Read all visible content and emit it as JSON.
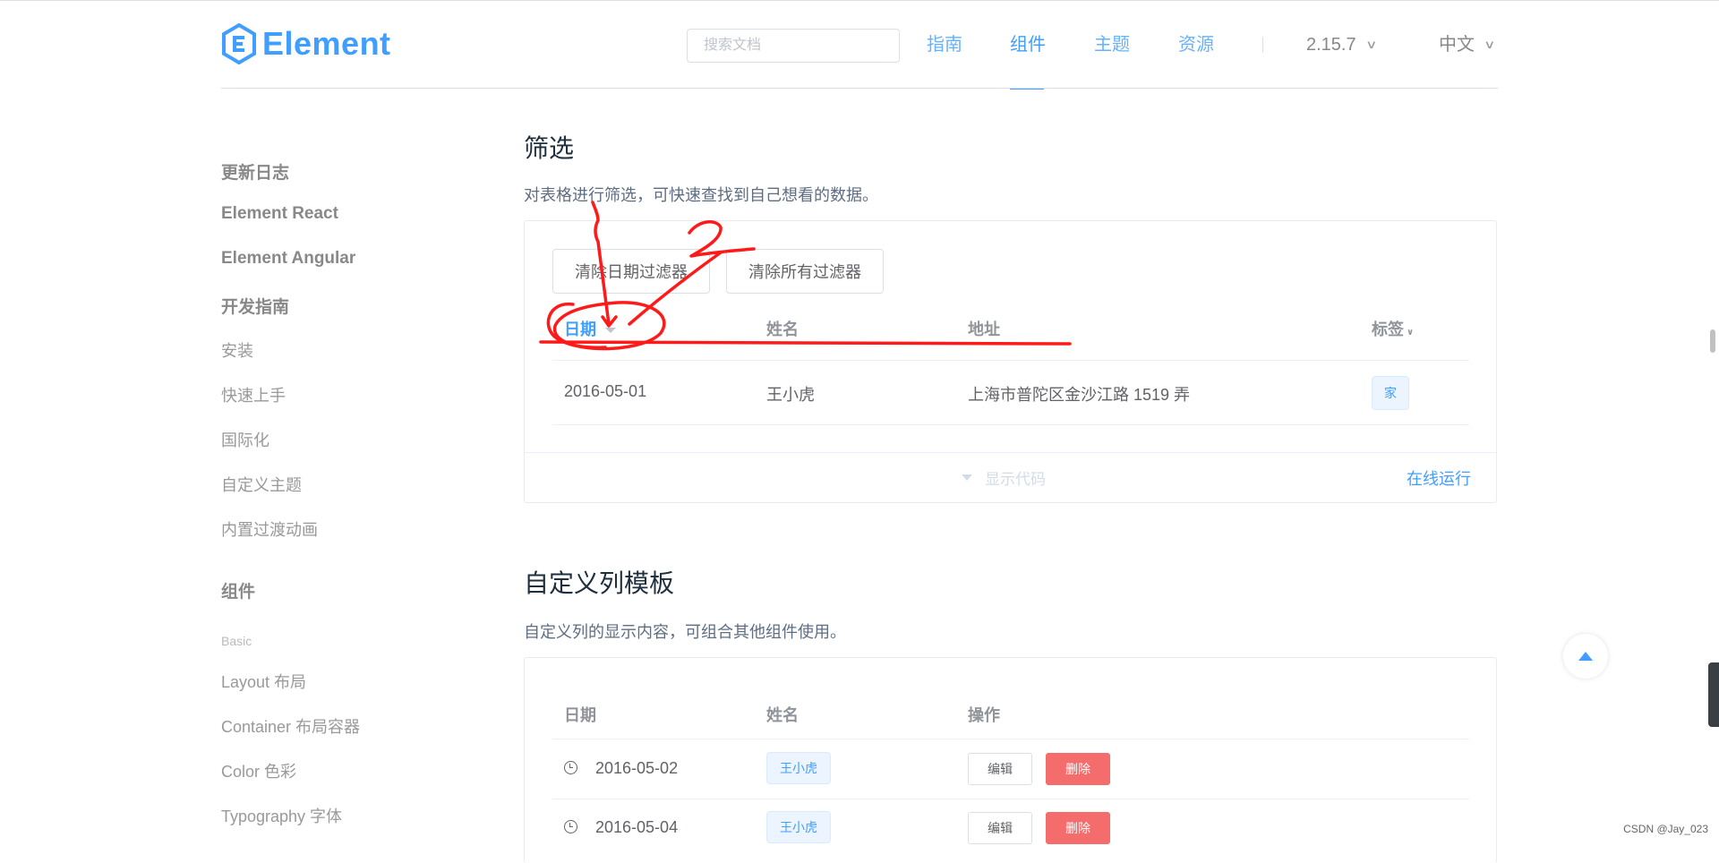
{
  "header": {
    "logo_text": "Element",
    "search_placeholder": "搜索文档",
    "nav": [
      "指南",
      "组件",
      "主题",
      "资源"
    ],
    "active_nav": "组件",
    "version": "2.15.7",
    "language": "中文"
  },
  "sidebar": {
    "items": [
      "更新日志",
      "Element React",
      "Element Angular",
      "开发指南",
      "安装",
      "快速上手",
      "国际化",
      "自定义主题",
      "内置过渡动画",
      "组件",
      "Basic",
      "Layout 布局",
      "Container 布局容器",
      "Color 色彩",
      "Typography 字体"
    ]
  },
  "filter_section": {
    "title": "筛选",
    "desc": "对表格进行筛选，可快速查找到自己想看的数据。",
    "buttons": [
      "清除日期过滤器",
      "清除所有过滤器"
    ],
    "columns": [
      "日期",
      "姓名",
      "地址",
      "标签"
    ],
    "row": {
      "date": "2016-05-01",
      "name": "王小虎",
      "address": "上海市普陀区金沙江路 1519 弄",
      "tag": "家"
    },
    "show_code": "显示代码",
    "run_online": "在线运行"
  },
  "custom_section": {
    "title": "自定义列模板",
    "desc": "自定义列的显示内容，可组合其他组件使用。",
    "columns": [
      "日期",
      "姓名",
      "操作"
    ],
    "rows": [
      {
        "date": "2016-05-02",
        "name": "王小虎",
        "edit": "编辑",
        "delete": "删除"
      },
      {
        "date": "2016-05-04",
        "name": "王小虎",
        "edit": "编辑",
        "delete": "删除"
      }
    ]
  },
  "watermark": "CSDN @Jay_023",
  "colors": {
    "brand": "#409eff",
    "danger": "#f56c6c",
    "annotation": "#ff1a1a"
  }
}
